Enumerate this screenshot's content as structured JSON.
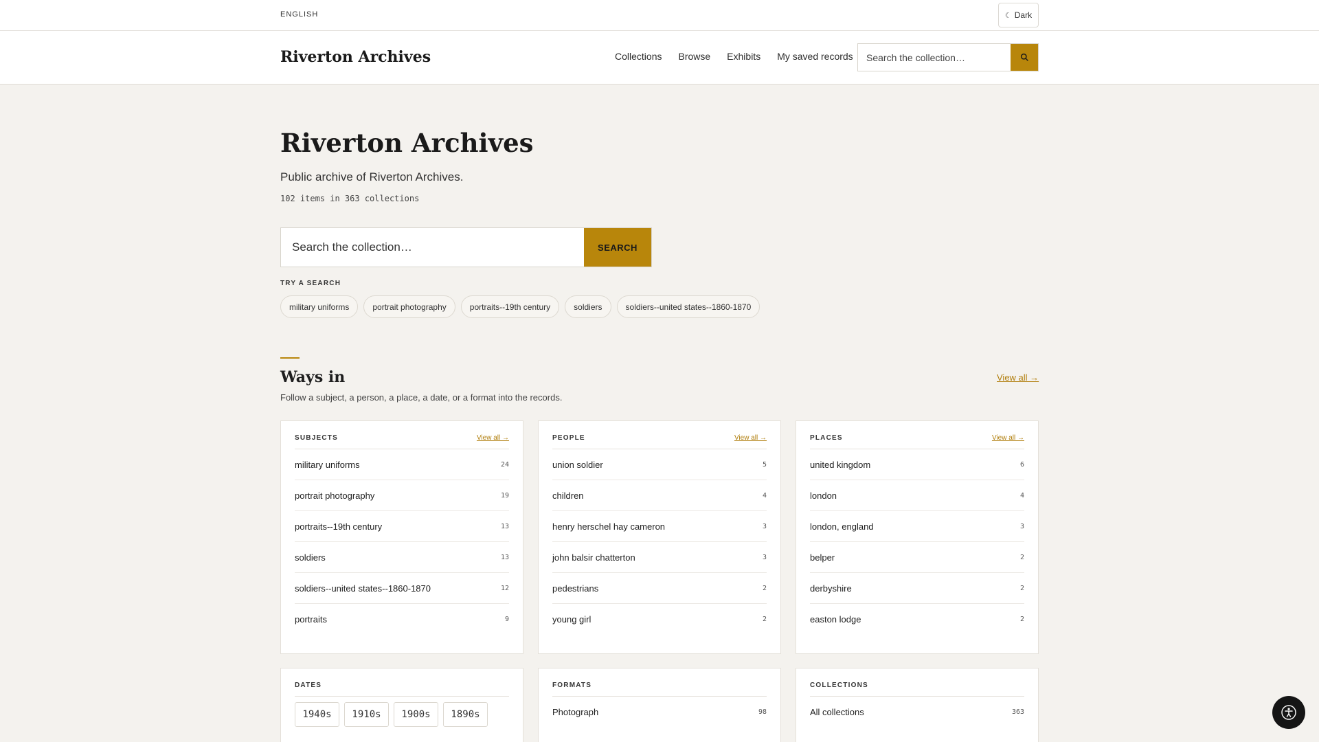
{
  "util": {
    "language": "ENGLISH",
    "dark_label": "Dark"
  },
  "header": {
    "brand": "Riverton Archives",
    "nav": [
      "Collections",
      "Browse",
      "Exhibits",
      "My saved records"
    ],
    "search_placeholder": "Search the collection…"
  },
  "hero": {
    "title": "Riverton Archives",
    "subtitle": "Public archive of Riverton Archives.",
    "count": "102 items in 363 collections",
    "search_placeholder": "Search the collection…",
    "search_button": "SEARCH"
  },
  "try_search": {
    "label": "TRY A SEARCH",
    "chips": [
      "military uniforms",
      "portrait photography",
      "portraits--19th century",
      "soldiers",
      "soldiers--united states--1860-1870"
    ]
  },
  "ways_in": {
    "title": "Ways in",
    "subtitle": "Follow a subject, a person, a place, a date, or a format into the records.",
    "view_all": "View all →",
    "cards": {
      "subjects": {
        "title": "SUBJECTS",
        "view_all": "View all →",
        "rows": [
          {
            "label": "military uniforms",
            "count": "24"
          },
          {
            "label": "portrait photography",
            "count": "19"
          },
          {
            "label": "portraits--19th century",
            "count": "13"
          },
          {
            "label": "soldiers",
            "count": "13"
          },
          {
            "label": "soldiers--united states--1860-1870",
            "count": "12"
          },
          {
            "label": "portraits",
            "count": "9"
          }
        ]
      },
      "people": {
        "title": "PEOPLE",
        "view_all": "View all →",
        "rows": [
          {
            "label": "union soldier",
            "count": "5"
          },
          {
            "label": "children",
            "count": "4"
          },
          {
            "label": "henry herschel hay cameron",
            "count": "3"
          },
          {
            "label": "john balsir chatterton",
            "count": "3"
          },
          {
            "label": "pedestrians",
            "count": "2"
          },
          {
            "label": "young girl",
            "count": "2"
          }
        ]
      },
      "places": {
        "title": "PLACES",
        "view_all": "View all →",
        "rows": [
          {
            "label": "united kingdom",
            "count": "6"
          },
          {
            "label": "london",
            "count": "4"
          },
          {
            "label": "london, england",
            "count": "3"
          },
          {
            "label": "belper",
            "count": "2"
          },
          {
            "label": "derbyshire",
            "count": "2"
          },
          {
            "label": "easton lodge",
            "count": "2"
          }
        ]
      },
      "dates": {
        "title": "DATES",
        "decades": [
          "1940s",
          "1910s",
          "1900s",
          "1890s"
        ]
      },
      "formats": {
        "title": "FORMATS",
        "rows": [
          {
            "label": "Photograph",
            "count": "98"
          }
        ]
      },
      "collections": {
        "title": "COLLECTIONS",
        "rows": [
          {
            "label": "All collections",
            "count": "363"
          }
        ]
      }
    }
  },
  "icons": {
    "accent_color": "#b8860b",
    "search": "search-icon",
    "moon": "moon-icon",
    "accessibility": "accessibility-icon"
  }
}
